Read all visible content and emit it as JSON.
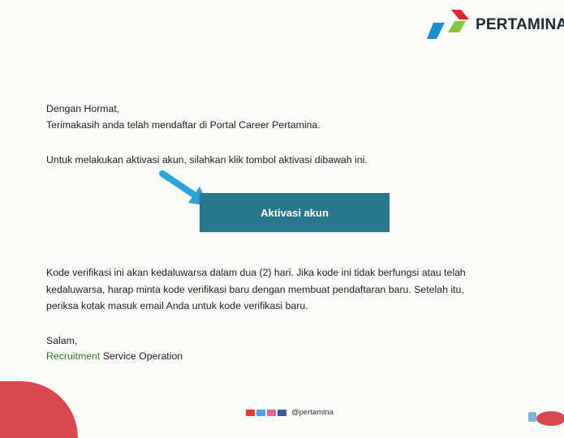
{
  "brand": {
    "name": "PERTAMINA"
  },
  "email": {
    "greeting": "Dengan Hormat,",
    "thanks": "Terimakasih anda telah mendaftar di Portal Career Pertamina.",
    "instruction": "Untuk melakukan aktivasi akun, silahkan klik tombol aktivasi dibawah ini.",
    "button_label": "Aktivasi akun",
    "notice_lines": [
      "Kode verifikasi ini akan kedaluwarsa dalam dua (2) hari. Jika kode ini tidak berfungsi atau telah",
      "kedaluwarsa, harap minta kode verifikasi baru dengan membuat pendaftaran baru. Setelah itu,",
      "periksa kotak masuk email Anda untuk kode verifikasi baru."
    ],
    "closing": "Salam,",
    "signature_highlight": "Recruitment",
    "signature_rest": " Service Operation"
  },
  "footer": {
    "social_icons": [
      "youtube-icon",
      "twitter-icon",
      "instagram-icon",
      "facebook-icon"
    ],
    "handle": "@pertamina"
  },
  "colors": {
    "button": "#27788f",
    "arrow": "#2aa3d8",
    "signature_green": "#2f7d2c",
    "footer_red": "#d8484f"
  }
}
